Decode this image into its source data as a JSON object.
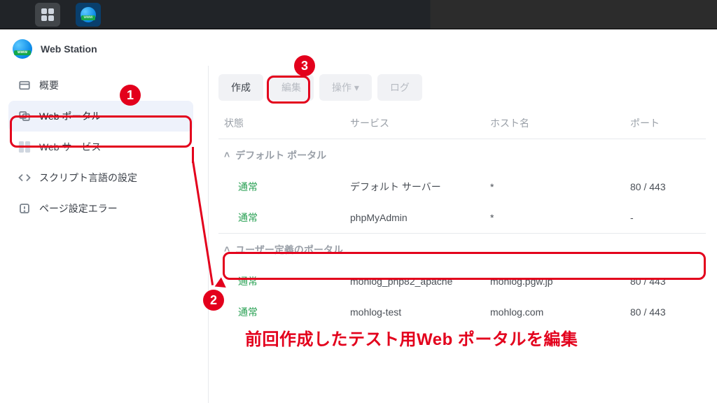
{
  "app_title": "Web Station",
  "sidebar": {
    "items": [
      {
        "label": "概要"
      },
      {
        "label": "Web ポータル"
      },
      {
        "label": "Web サービス"
      },
      {
        "label": "スクリプト言語の設定"
      },
      {
        "label": "ページ設定エラー"
      }
    ]
  },
  "toolbar": {
    "create": "作成",
    "edit": "編集",
    "operate": "操作",
    "operate_suffix": " ▾",
    "log": "ログ"
  },
  "table": {
    "headers": {
      "status": "状態",
      "service": "サービス",
      "host": "ホスト名",
      "port": "ポート"
    },
    "groups": [
      {
        "name": "デフォルト ポータル",
        "rows": [
          {
            "status": "通常",
            "service": "デフォルト サーバー",
            "host": "*",
            "port": "80 / 443"
          },
          {
            "status": "通常",
            "service": "phpMyAdmin",
            "host": "*",
            "port": "-"
          }
        ]
      },
      {
        "name": "ユーザー定義のポータル",
        "rows": [
          {
            "status": "通常",
            "service": "mohlog_php82_apache",
            "host": "mohlog.pgw.jp",
            "port": "80 / 443"
          },
          {
            "status": "通常",
            "service": "mohlog-test",
            "host": "mohlog.com",
            "port": "80 / 443"
          }
        ]
      }
    ]
  },
  "annotations": {
    "n1": "1",
    "n2": "2",
    "n3": "3",
    "caption": "前回作成したテスト用Web ポータルを編集"
  }
}
